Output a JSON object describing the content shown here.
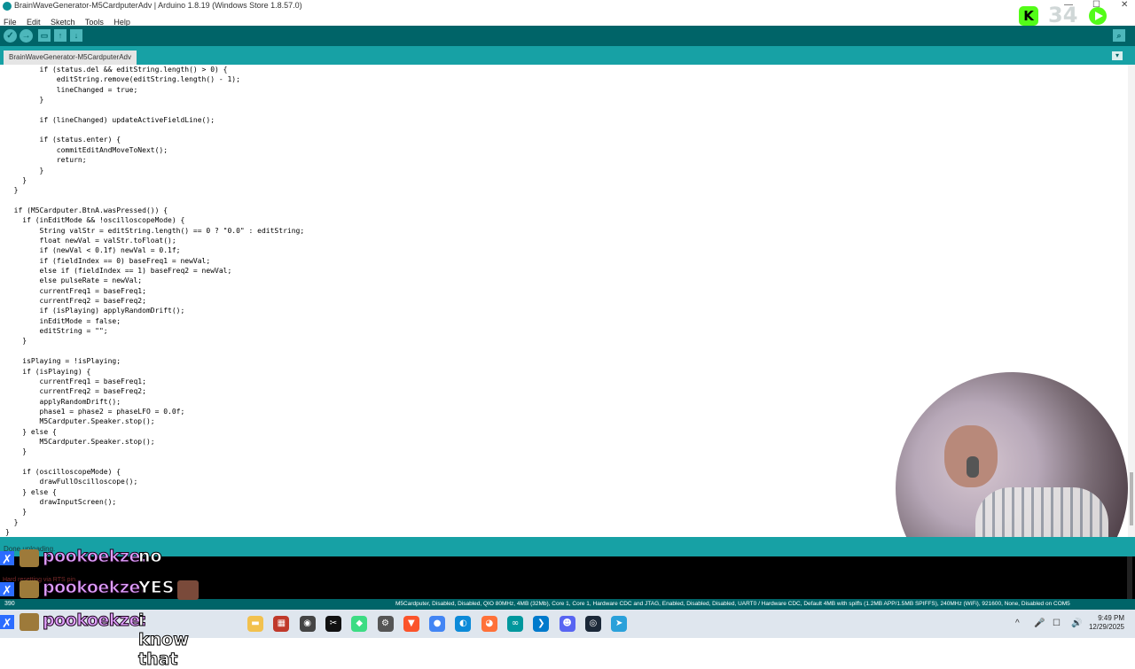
{
  "window": {
    "title": "BrainWaveGenerator-M5CardputerAdv | Arduino 1.8.19 (Windows Store 1.8.57.0)",
    "controls": [
      "—",
      "☐",
      "✕"
    ]
  },
  "menu": [
    "File",
    "Edit",
    "Sketch",
    "Tools",
    "Help"
  ],
  "toolbar": {
    "verify": "✓",
    "upload": "→",
    "new": "▭",
    "open": "↑",
    "save": "↓",
    "serial_monitor": "⌕"
  },
  "tabs": {
    "active": "BrainWaveGenerator-M5CardputerAdv",
    "menu": "▾"
  },
  "code": [
    "        if (status.del && editString.length() > 0) {",
    "            editString.remove(editString.length() - 1);",
    "            lineChanged = true;",
    "        }",
    "",
    "        if (lineChanged) updateActiveFieldLine();",
    "",
    "        if (status.enter) {",
    "            commitEditAndMoveToNext();",
    "            return;",
    "        }",
    "    }",
    "  }",
    "",
    "  if (M5Cardputer.BtnA.wasPressed()) {",
    "    if (inEditMode && !oscilloscopeMode) {",
    "        String valStr = editString.length() == 0 ? \"0.0\" : editString;",
    "        float newVal = valStr.toFloat();",
    "        if (newVal < 0.1f) newVal = 0.1f;",
    "        if (fieldIndex == 0) baseFreq1 = newVal;",
    "        else if (fieldIndex == 1) baseFreq2 = newVal;",
    "        else pulseRate = newVal;",
    "        currentFreq1 = baseFreq1;",
    "        currentFreq2 = baseFreq2;",
    "        if (isPlaying) applyRandomDrift();",
    "        inEditMode = false;",
    "        editString = \"\";",
    "    }",
    "",
    "    isPlaying = !isPlaying;",
    "    if (isPlaying) {",
    "        currentFreq1 = baseFreq1;",
    "        currentFreq2 = baseFreq2;",
    "        applyRandomDrift();",
    "        phase1 = phase2 = phaseLFO = 0.0f;",
    "        M5Cardputer.Speaker.stop();",
    "    } else {",
    "        M5Cardputer.Speaker.stop();",
    "    }",
    "",
    "    if (oscilloscopeMode) {",
    "        drawFullOscilloscope();",
    "    } else {",
    "        drawInputScreen();",
    "    }",
    "  }",
    "}"
  ],
  "status": {
    "message": "Done uploading.",
    "console_faded": "Hard resetting via RTS pin...",
    "line_number": "390",
    "board_info": "M5Cardputer, Disabled, Disabled, QIO 80MHz, 4MB (32Mb), Core 1, Core 1, Hardware CDC and JTAG, Enabled, Disabled, Disabled, UART0 / Hardware CDC, Default 4MB with spiffs (1.2MB APP/1.5MB SPIFFS), 240MHz (WiFi), 921600, None, Disabled on COM5"
  },
  "chat": [
    {
      "user": "pookoekze:",
      "text": "no"
    },
    {
      "user": "pookoekze:",
      "text": "YES"
    },
    {
      "user": "pookoekze:",
      "text": "i know that"
    }
  ],
  "overlay": {
    "kick_logo": "K",
    "viewer_count": "34"
  },
  "taskbar": {
    "apps": [
      {
        "name": "file-explorer",
        "glyph": "▬",
        "color": "#f2c14e"
      },
      {
        "name": "game-app",
        "glyph": "▦",
        "color": "#c0392b"
      },
      {
        "name": "obs",
        "glyph": "◉",
        "color": "#444444"
      },
      {
        "name": "capcut",
        "glyph": "✂",
        "color": "#111111"
      },
      {
        "name": "android-studio",
        "glyph": "◆",
        "color": "#3ddc84"
      },
      {
        "name": "settings",
        "glyph": "⚙",
        "color": "#555555"
      },
      {
        "name": "brave",
        "glyph": "▼",
        "color": "#fb542b"
      },
      {
        "name": "chrome",
        "glyph": "●",
        "color": "#4285f4"
      },
      {
        "name": "edge",
        "glyph": "◐",
        "color": "#0c8ad8"
      },
      {
        "name": "firefox",
        "glyph": "◕",
        "color": "#ff7139"
      },
      {
        "name": "arduino",
        "glyph": "∞",
        "color": "#00979d"
      },
      {
        "name": "vscode",
        "glyph": "❯",
        "color": "#007acc"
      },
      {
        "name": "discord",
        "glyph": "☻",
        "color": "#5865f2"
      },
      {
        "name": "steam",
        "glyph": "◎",
        "color": "#1b2838"
      },
      {
        "name": "telegram",
        "glyph": "➤",
        "color": "#2aa1da"
      }
    ],
    "tray": [
      "^",
      "🎤",
      "☐",
      "🔊"
    ],
    "time": "9:49 PM",
    "date": "12/29/2025"
  }
}
